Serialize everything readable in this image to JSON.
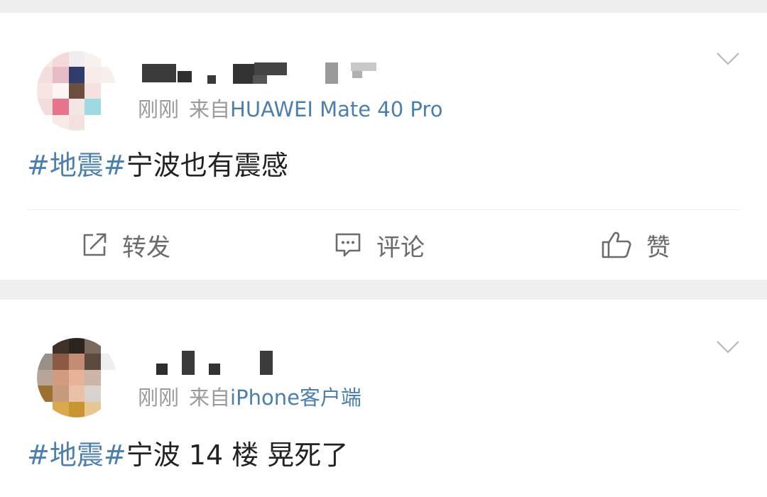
{
  "posts": [
    {
      "time": "刚刚",
      "from_prefix": "来自",
      "device": "HUAWEI Mate 40 Pro",
      "hashtag": "#地震#",
      "text": "宁波也有震感",
      "actions": {
        "repost": "转发",
        "comment": "评论",
        "like": "赞"
      }
    },
    {
      "time": "刚刚",
      "from_prefix": "来自",
      "device": "iPhone客户端",
      "hashtag": "#地震#",
      "text": "宁波 14 楼 晃死了"
    }
  ],
  "colors": {
    "link": "#4a7fb0",
    "meta_gray": "#9a9a9a",
    "text": "#222222",
    "action_gray": "#6b6b6b",
    "background": "#efefef"
  },
  "icons": {
    "menu": "chevron-down-icon",
    "repost": "edit-share-icon",
    "comment": "comment-bubble-icon",
    "like": "thumbs-up-icon"
  }
}
